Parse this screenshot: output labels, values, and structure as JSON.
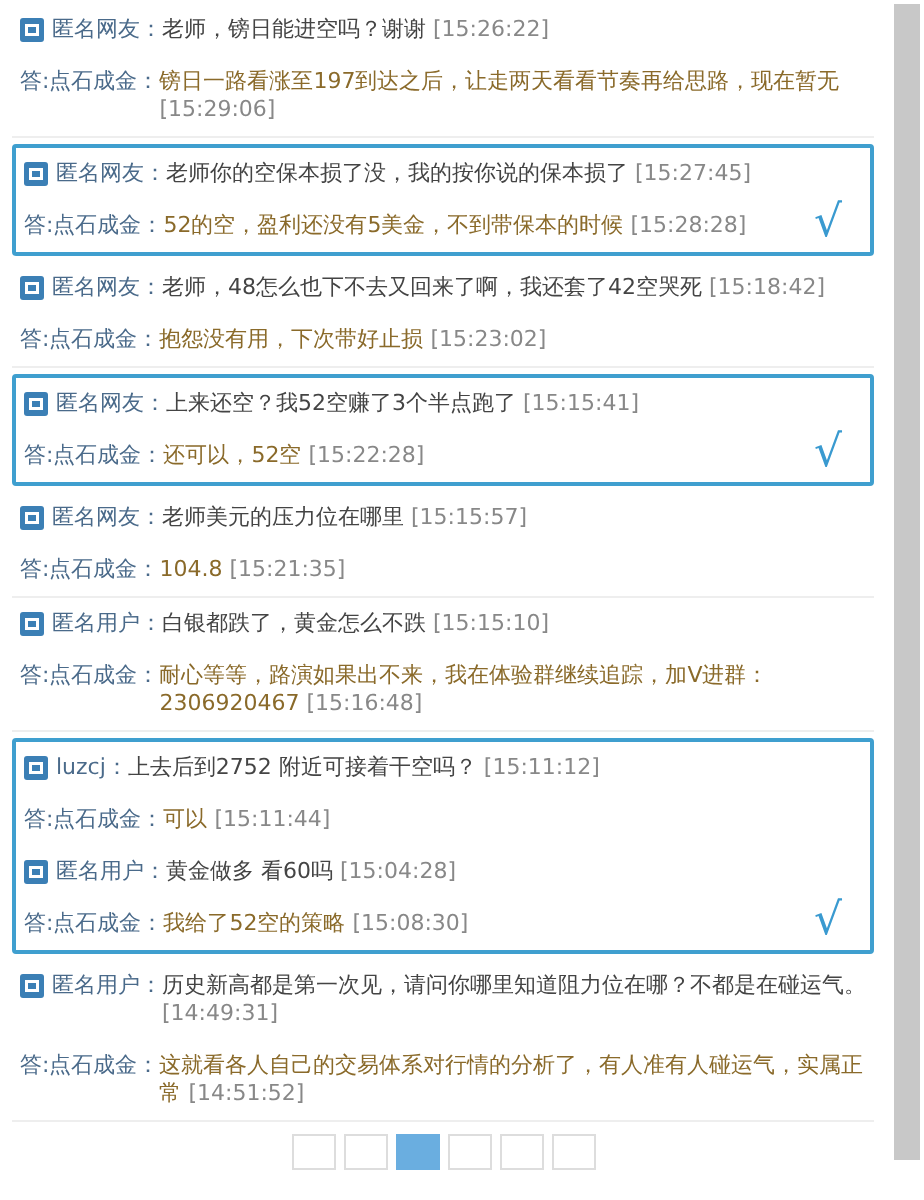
{
  "groups": [
    {
      "highlighted": false,
      "qas": [
        {
          "asker": "匿名网友：",
          "question": "老师，镑日能进空吗？谢谢",
          "q_time": "[15:26:22]",
          "answer_prefix": "答:",
          "answerer": "点石成金：",
          "answer": "镑日一路看涨至197到达之后，让走两天看看节奏再给思路，现在暂无",
          "a_time": "[15:29:06]"
        }
      ]
    },
    {
      "highlighted": true,
      "mark": "√",
      "qas": [
        {
          "asker": "匿名网友：",
          "question": "老师你的空保本损了没，我的按你说的保本损了",
          "q_time": "[15:27:45]",
          "answer_prefix": "答:",
          "answerer": "点石成金：",
          "answer": "52的空，盈利还没有5美金，不到带保本的时候",
          "a_time": "[15:28:28]"
        }
      ]
    },
    {
      "highlighted": false,
      "qas": [
        {
          "asker": "匿名网友：",
          "question": "老师，48怎么也下不去又回来了啊，我还套了42空哭死",
          "q_time": "[15:18:42]",
          "answer_prefix": "答:",
          "answerer": "点石成金：",
          "answer": "抱怨没有用，下次带好止损",
          "a_time": "[15:23:02]"
        }
      ]
    },
    {
      "highlighted": true,
      "mark": "√",
      "qas": [
        {
          "asker": "匿名网友：",
          "question": "上来还空？我52空赚了3个半点跑了",
          "q_time": "[15:15:41]",
          "answer_prefix": "答:",
          "answerer": "点石成金：",
          "answer": "还可以，52空",
          "a_time": "[15:22:28]"
        }
      ]
    },
    {
      "highlighted": false,
      "qas": [
        {
          "asker": "匿名网友：",
          "question": "老师美元的压力位在哪里",
          "q_time": "[15:15:57]",
          "answer_prefix": "答:",
          "answerer": "点石成金：",
          "answer": "104.8",
          "a_time": "[15:21:35]"
        }
      ]
    },
    {
      "highlighted": false,
      "qas": [
        {
          "asker": "匿名用户：",
          "question": "白银都跌了，黄金怎么不跌",
          "q_time": "[15:15:10]",
          "answer_prefix": "答:",
          "answerer": "点石成金：",
          "answer": "耐心等等，路演如果出不来，我在体验群继续追踪，加V进群：2306920467",
          "a_time": "[15:16:48]"
        }
      ]
    },
    {
      "highlighted": true,
      "mark": "√",
      "qas": [
        {
          "asker": "luzcj：",
          "question": "上去后到2752 附近可接着干空吗？",
          "q_time": "[15:11:12]",
          "answer_prefix": "答:",
          "answerer": "点石成金：",
          "answer": "可以",
          "a_time": "[15:11:44]"
        },
        {
          "asker": "匿名用户：",
          "question": "黄金做多 看60吗",
          "q_time": "[15:04:28]",
          "answer_prefix": "答:",
          "answerer": "点石成金：",
          "answer": "我给了52空的策略",
          "a_time": "[15:08:30]"
        }
      ]
    },
    {
      "highlighted": false,
      "qas": [
        {
          "asker": "匿名用户：",
          "question": "历史新高都是第一次见，请问你哪里知道阻力位在哪？不都是在碰运气。",
          "q_time": "[14:49:31]",
          "answer_prefix": "答:",
          "answerer": "点石成金：",
          "answer": "这就看各人自己的交易体系对行情的分析了，有人准有人碰运气，实属正常",
          "a_time": "[14:51:52]"
        }
      ]
    }
  ],
  "pager": [
    {
      "selected": false
    },
    {
      "selected": false
    },
    {
      "selected": true
    },
    {
      "selected": false
    },
    {
      "selected": false
    },
    {
      "selected": false
    }
  ]
}
